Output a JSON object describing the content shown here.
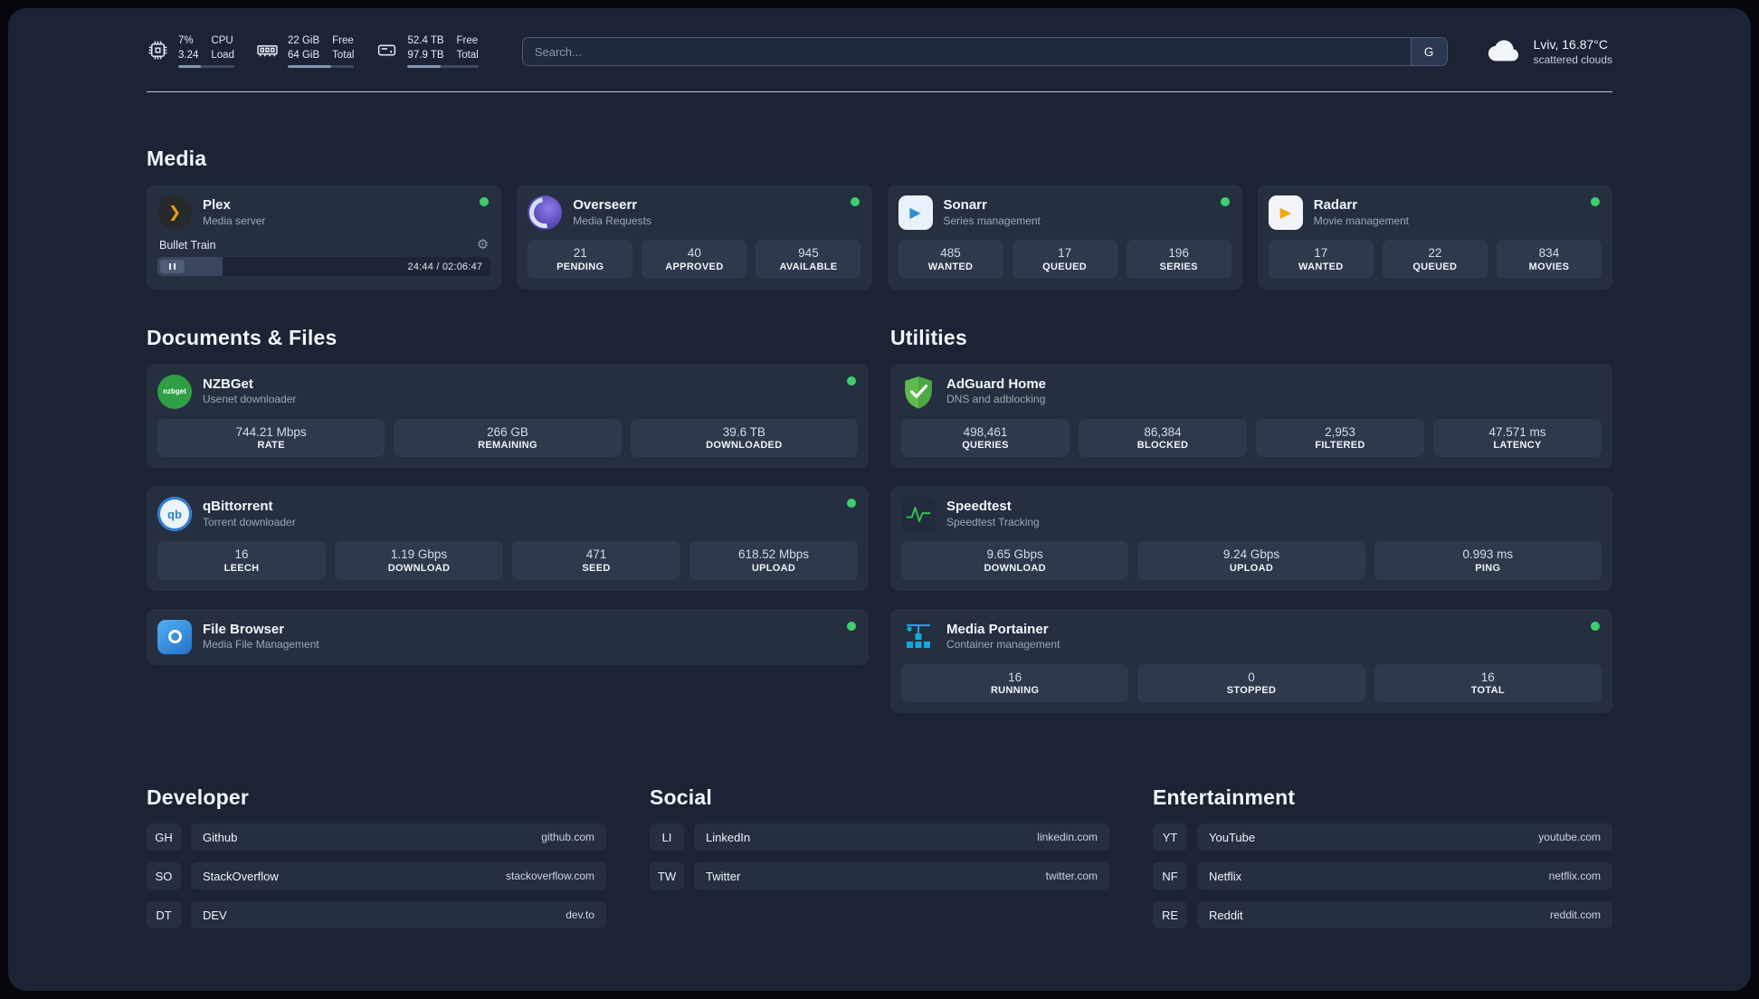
{
  "colors": {
    "background": "#1b2334",
    "card": "#262f40",
    "stat_box": "#2e394c",
    "status_online": "#3ecf6e",
    "plex_amber": "#e5a00d",
    "adguard_green": "#5fbb4e",
    "portainer_blue": "#13a8e0"
  },
  "icons": {
    "plex_glyph": "❯",
    "sonarr_glyph": "▶",
    "radarr_glyph": "▶",
    "nzbget_text": "nzbget",
    "qbittorrent_text": "qb",
    "gear_glyph": "⚙"
  },
  "topbar": {
    "cpu": {
      "value1": "7%",
      "value2": "3.24",
      "label1": "CPU",
      "label2": "Load",
      "progress_percent": 40
    },
    "memory": {
      "value1": "22 GiB",
      "value2": "64 GiB",
      "label1": "Free",
      "label2": "Total",
      "progress_percent": 66
    },
    "disk": {
      "value1": "52.4 TB",
      "value2": "97.9 TB",
      "label1": "Free",
      "label2": "Total",
      "progress_percent": 47
    },
    "search": {
      "placeholder": "Search...",
      "engine_label": "G",
      "value": ""
    },
    "weather": {
      "location": "Lviv, 16.87°C",
      "condition": "scattered clouds"
    }
  },
  "media": {
    "heading": "Media",
    "apps": [
      {
        "name": "Plex",
        "subtitle": "Media server",
        "status": "online",
        "player": {
          "track": "Bullet Train",
          "time": "24:44 / 02:06:47",
          "progress_percent": 19.5
        }
      },
      {
        "name": "Overseerr",
        "subtitle": "Media Requests",
        "status": "online",
        "stats": [
          {
            "value": "21",
            "label": "PENDING"
          },
          {
            "value": "40",
            "label": "APPROVED"
          },
          {
            "value": "945",
            "label": "AVAILABLE"
          }
        ]
      },
      {
        "name": "Sonarr",
        "subtitle": "Series management",
        "status": "online",
        "stats": [
          {
            "value": "485",
            "label": "WANTED"
          },
          {
            "value": "17",
            "label": "QUEUED"
          },
          {
            "value": "196",
            "label": "SERIES"
          }
        ]
      },
      {
        "name": "Radarr",
        "subtitle": "Movie management",
        "status": "online",
        "stats": [
          {
            "value": "17",
            "label": "WANTED"
          },
          {
            "value": "22",
            "label": "QUEUED"
          },
          {
            "value": "834",
            "label": "MOVIES"
          }
        ]
      }
    ]
  },
  "documents": {
    "heading": "Documents & Files",
    "apps": [
      {
        "name": "NZBGet",
        "subtitle": "Usenet downloader",
        "status": "online",
        "stats": [
          {
            "value": "744.21 Mbps",
            "label": "RATE"
          },
          {
            "value": "266 GB",
            "label": "REMAINING"
          },
          {
            "value": "39.6 TB",
            "label": "DOWNLOADED"
          }
        ]
      },
      {
        "name": "qBittorrent",
        "subtitle": "Torrent downloader",
        "status": "online",
        "stats": [
          {
            "value": "16",
            "label": "LEECH"
          },
          {
            "value": "1.19 Gbps",
            "label": "DOWNLOAD"
          },
          {
            "value": "471",
            "label": "SEED"
          },
          {
            "value": "618.52 Mbps",
            "label": "UPLOAD"
          }
        ]
      },
      {
        "name": "File Browser",
        "subtitle": "Media File Management",
        "status": "online"
      }
    ]
  },
  "utilities": {
    "heading": "Utilities",
    "apps": [
      {
        "name": "AdGuard Home",
        "subtitle": "DNS and adblocking",
        "stats": [
          {
            "value": "498,461",
            "label": "QUERIES"
          },
          {
            "value": "86,384",
            "label": "BLOCKED"
          },
          {
            "value": "2,953",
            "label": "FILTERED"
          },
          {
            "value": "47.571 ms",
            "label": "LATENCY"
          }
        ]
      },
      {
        "name": "Speedtest",
        "subtitle": "Speedtest Tracking",
        "stats": [
          {
            "value": "9.65 Gbps",
            "label": "DOWNLOAD"
          },
          {
            "value": "9.24 Gbps",
            "label": "UPLOAD"
          },
          {
            "value": "0.993 ms",
            "label": "PING"
          }
        ]
      },
      {
        "name": "Media Portainer",
        "subtitle": "Container management",
        "status": "online",
        "stats": [
          {
            "value": "16",
            "label": "RUNNING"
          },
          {
            "value": "0",
            "label": "STOPPED"
          },
          {
            "value": "16",
            "label": "TOTAL"
          }
        ]
      }
    ]
  },
  "links": [
    {
      "heading": "Developer",
      "items": [
        {
          "abbr": "GH",
          "name": "Github",
          "url": "github.com"
        },
        {
          "abbr": "SO",
          "name": "StackOverflow",
          "url": "stackoverflow.com"
        },
        {
          "abbr": "DT",
          "name": "DEV",
          "url": "dev.to"
        }
      ]
    },
    {
      "heading": "Social",
      "items": [
        {
          "abbr": "LI",
          "name": "LinkedIn",
          "url": "linkedin.com"
        },
        {
          "abbr": "TW",
          "name": "Twitter",
          "url": "twitter.com"
        }
      ]
    },
    {
      "heading": "Entertainment",
      "items": [
        {
          "abbr": "YT",
          "name": "YouTube",
          "url": "youtube.com"
        },
        {
          "abbr": "NF",
          "name": "Netflix",
          "url": "netflix.com"
        },
        {
          "abbr": "RE",
          "name": "Reddit",
          "url": "reddit.com"
        }
      ]
    }
  ]
}
